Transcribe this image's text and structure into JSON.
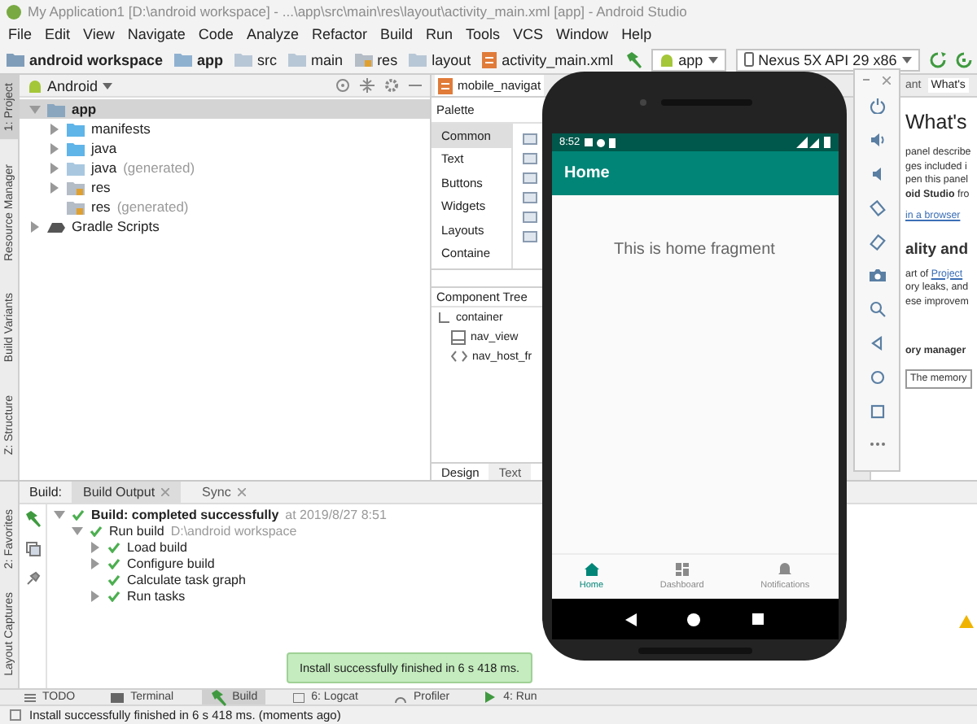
{
  "window": {
    "title": "My Application1 [D:\\android workspace] - ...\\app\\src\\main\\res\\layout\\activity_main.xml [app] - Android Studio"
  },
  "menu": [
    "File",
    "Edit",
    "View",
    "Navigate",
    "Code",
    "Analyze",
    "Refactor",
    "Build",
    "Run",
    "Tools",
    "VCS",
    "Window",
    "Help"
  ],
  "breadcrumbs": [
    {
      "label": "android workspace",
      "kind": "project"
    },
    {
      "label": "app",
      "kind": "module"
    },
    {
      "label": "src",
      "kind": "folder"
    },
    {
      "label": "main",
      "kind": "folder"
    },
    {
      "label": "res",
      "kind": "res"
    },
    {
      "label": "layout",
      "kind": "folder"
    },
    {
      "label": "activity_main.xml",
      "kind": "file"
    }
  ],
  "run_config": {
    "module": "app",
    "device": "Nexus 5X API 29 x86"
  },
  "left_tools": [
    {
      "label": "1: Project",
      "selected": true
    },
    {
      "label": "Resource Manager",
      "selected": false
    },
    {
      "label": "Build Variants",
      "selected": false
    },
    {
      "label": "Z: Structure",
      "selected": false
    }
  ],
  "project_panel": {
    "view": "Android",
    "tree": [
      {
        "label": "app",
        "kind": "module",
        "expandable": true,
        "expanded": true,
        "selected": true,
        "children": [
          {
            "label": "manifests",
            "kind": "folder",
            "expandable": true,
            "expanded": false,
            "selected": false
          },
          {
            "label": "java",
            "kind": "folder",
            "expandable": true,
            "expanded": false,
            "selected": false
          },
          {
            "label": "java",
            "note": "(generated)",
            "kind": "generated",
            "expandable": true,
            "expanded": false,
            "selected": false
          },
          {
            "label": "res",
            "kind": "res",
            "expandable": true,
            "expanded": false,
            "selected": false
          },
          {
            "label": "res",
            "note": "(generated)",
            "kind": "res",
            "expandable": false,
            "expanded": false,
            "selected": false
          }
        ]
      },
      {
        "label": "Gradle Scripts",
        "kind": "gradle",
        "expandable": true,
        "expanded": false,
        "selected": false
      }
    ]
  },
  "editor": {
    "tabs": [
      {
        "label": "mobile_navigat",
        "selected": true
      }
    ],
    "palette": {
      "title": "Palette",
      "categories": [
        {
          "label": "Common",
          "selected": true
        },
        {
          "label": "Text",
          "selected": false
        },
        {
          "label": "Buttons",
          "selected": false
        },
        {
          "label": "Widgets",
          "selected": false
        },
        {
          "label": "Layouts",
          "selected": false
        },
        {
          "label": "Containe",
          "selected": false
        }
      ]
    },
    "component_tree": {
      "title": "Component Tree",
      "items": [
        {
          "label": "container",
          "kind": "layout",
          "children": [
            {
              "label": "nav_view",
              "kind": "navigation"
            },
            {
              "label": "nav_host_fr",
              "kind": "fragment"
            }
          ]
        }
      ]
    },
    "view_tabs": [
      {
        "label": "Design",
        "selected": true
      },
      {
        "label": "Text",
        "selected": false
      }
    ]
  },
  "whats_new": {
    "tabs": [
      {
        "label": "ant",
        "selected": false
      },
      {
        "label": "What's",
        "selected": true
      }
    ],
    "lines": [
      {
        "kind": "heading",
        "text": "What's"
      },
      {
        "kind": "text",
        "text": "panel describe"
      },
      {
        "kind": "text",
        "text": "ges included i"
      },
      {
        "kind": "text",
        "text": "pen this panel"
      },
      {
        "kind": "text",
        "text": "**oid Studio** fro"
      },
      {
        "kind": "link",
        "text": "in a browser"
      },
      {
        "kind": "subheading",
        "text": "ality and"
      },
      {
        "kind": "text",
        "text": "art of",
        "link": "Project"
      },
      {
        "kind": "text",
        "text": "ory leaks, and"
      },
      {
        "kind": "text",
        "text": "ese improvem"
      },
      {
        "kind": "bold",
        "text": "ory manager"
      },
      {
        "kind": "boxed",
        "text": "The memory"
      }
    ]
  },
  "emulator": {
    "time": "8:52",
    "app_title": "Home",
    "message": "This is home fragment",
    "bottom_nav": [
      {
        "label": "Home",
        "kind": "home",
        "selected": true
      },
      {
        "label": "Dashboard",
        "kind": "dashboard",
        "selected": false
      },
      {
        "label": "Notifications",
        "kind": "bell",
        "selected": false
      }
    ]
  },
  "emulator_toolbar": [
    {
      "kind": "power"
    },
    {
      "kind": "volume_up"
    },
    {
      "kind": "volume_down"
    },
    {
      "kind": "rotate_left"
    },
    {
      "kind": "rotate_right"
    },
    {
      "kind": "camera"
    },
    {
      "kind": "zoom"
    },
    {
      "kind": "back"
    },
    {
      "kind": "home"
    },
    {
      "kind": "overview"
    },
    {
      "kind": "more"
    }
  ],
  "build_panel": {
    "title": "Build:",
    "tabs": [
      {
        "label": "Build Output",
        "selected": true
      },
      {
        "label": "Sync",
        "selected": false
      }
    ],
    "tree": [
      {
        "label": "Build: completed successfully",
        "note": "at 2019/8/27 8:51",
        "bold": true,
        "expandable": true,
        "expanded": true,
        "children": [
          {
            "label": "Run build",
            "note": "D:\\android workspace",
            "bold": false,
            "expandable": true,
            "expanded": true,
            "children": [
              {
                "label": "Load build",
                "bold": false,
                "expandable": true,
                "expanded": false
              },
              {
                "label": "Configure build",
                "bold": false,
                "expandable": true,
                "expanded": false
              },
              {
                "label": "Calculate task graph",
                "bold": false,
                "expandable": false,
                "expanded": false
              },
              {
                "label": "Run tasks",
                "bold": false,
                "expandable": true,
                "expanded": false
              }
            ]
          }
        ]
      }
    ]
  },
  "bottom_left_tools": [
    {
      "label": "2: Favorites"
    },
    {
      "label": "Layout Captures"
    }
  ],
  "toast": "Install successfully finished in 6 s 418 ms.",
  "tool_windows": [
    {
      "label": "TODO",
      "kind": "todo",
      "selected": false
    },
    {
      "label": "Terminal",
      "kind": "terminal",
      "selected": false
    },
    {
      "label": "Build",
      "kind": "build",
      "selected": true
    },
    {
      "label": "6: Logcat",
      "kind": "logcat",
      "selected": false
    },
    {
      "label": "Profiler",
      "kind": "profiler",
      "selected": false
    },
    {
      "label": "4: Run",
      "kind": "run",
      "selected": false
    }
  ],
  "status_bar": {
    "message": "Install successfully finished in 6 s 418 ms. (moments ago)"
  }
}
